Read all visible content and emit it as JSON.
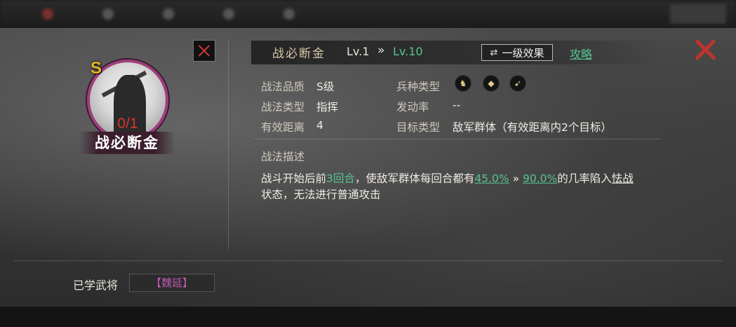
{
  "topbar": {
    "tabs": [
      "",
      "",
      "",
      "",
      ""
    ]
  },
  "portrait": {
    "grade": "S",
    "count": "0/1",
    "name": "战必断金"
  },
  "header": {
    "title": "战必断金",
    "level_current": "Lv.1",
    "level_arrow": "»",
    "level_max": "Lv.10",
    "effect_button": "一级效果",
    "effect_icon": "⇄",
    "guide_link": "攻略"
  },
  "attributes": {
    "quality_label": "战法品质",
    "quality_value": "S级",
    "type_label": "战法类型",
    "type_value": "指挥",
    "range_label": "有效距离",
    "range_value": "4",
    "troop_label": "兵种类型",
    "troop_icons": [
      "cavalry-icon",
      "shield-icon",
      "bow-icon"
    ],
    "rate_label": "发动率",
    "rate_value": "--",
    "target_label": "目标类型",
    "target_value": "敌军群体（有效距离内2个目标）"
  },
  "description": {
    "title": "战法描述",
    "part1": "战斗开始后前",
    "rounds": "3回合",
    "part2": "，使敌军群体每回合都有",
    "rate_min": "45.0%",
    "arrow": " » ",
    "rate_max": "90.0%",
    "part3": "的几率陷入",
    "status": "怯战",
    "part4": "状态，无法进行普通攻击"
  },
  "learned": {
    "label": "已学武将",
    "general": "【魏延】"
  },
  "colors": {
    "accent_green": "#57c491",
    "close_red": "#c0342c",
    "grade_gold": "#e8b72a",
    "general_purple": "#c25ab1"
  }
}
